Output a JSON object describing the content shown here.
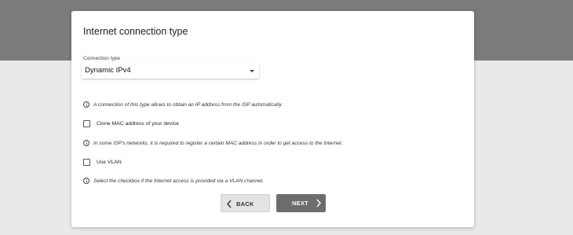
{
  "card": {
    "title": "Internet connection type"
  },
  "connection_type": {
    "label": "Connection type",
    "value": "Dynamic IPv4"
  },
  "info": {
    "ip_auto": "A connection of this type allows to obtain an IP address from the ISP automatically.",
    "mac_register": "In some ISP's networks, it is required to register a certain MAC address in order to get access to the Internet.",
    "vlan": "Select the checkbox if the Internet access is provided via a VLAN channel."
  },
  "options": {
    "clone_mac": {
      "label": "Clone MAC address of your device",
      "checked": false
    },
    "use_vlan": {
      "label": "Use VLAN",
      "checked": false
    }
  },
  "buttons": {
    "back": "BACK",
    "next": "NEXT"
  },
  "colors": {
    "header_band": "#7b7b7c",
    "page_background": "#e9e9ea",
    "next_button": "#6d6d6f",
    "back_button": "#e4e4e6"
  },
  "icons": {
    "info": "info-circle-icon",
    "dropdown": "caret-down-icon",
    "back": "chevron-left-icon",
    "next": "chevron-right-icon"
  }
}
